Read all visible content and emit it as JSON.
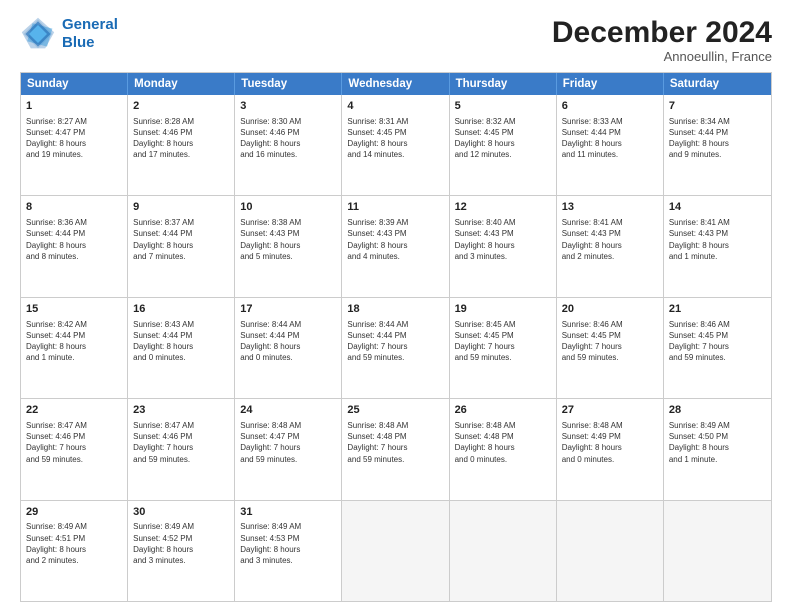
{
  "header": {
    "logo_line1": "General",
    "logo_line2": "Blue",
    "month": "December 2024",
    "location": "Annoeullin, France"
  },
  "days_of_week": [
    "Sunday",
    "Monday",
    "Tuesday",
    "Wednesday",
    "Thursday",
    "Friday",
    "Saturday"
  ],
  "weeks": [
    [
      {
        "day": "1",
        "lines": [
          "Sunrise: 8:27 AM",
          "Sunset: 4:47 PM",
          "Daylight: 8 hours",
          "and 19 minutes."
        ]
      },
      {
        "day": "2",
        "lines": [
          "Sunrise: 8:28 AM",
          "Sunset: 4:46 PM",
          "Daylight: 8 hours",
          "and 17 minutes."
        ]
      },
      {
        "day": "3",
        "lines": [
          "Sunrise: 8:30 AM",
          "Sunset: 4:46 PM",
          "Daylight: 8 hours",
          "and 16 minutes."
        ]
      },
      {
        "day": "4",
        "lines": [
          "Sunrise: 8:31 AM",
          "Sunset: 4:45 PM",
          "Daylight: 8 hours",
          "and 14 minutes."
        ]
      },
      {
        "day": "5",
        "lines": [
          "Sunrise: 8:32 AM",
          "Sunset: 4:45 PM",
          "Daylight: 8 hours",
          "and 12 minutes."
        ]
      },
      {
        "day": "6",
        "lines": [
          "Sunrise: 8:33 AM",
          "Sunset: 4:44 PM",
          "Daylight: 8 hours",
          "and 11 minutes."
        ]
      },
      {
        "day": "7",
        "lines": [
          "Sunrise: 8:34 AM",
          "Sunset: 4:44 PM",
          "Daylight: 8 hours",
          "and 9 minutes."
        ]
      }
    ],
    [
      {
        "day": "8",
        "lines": [
          "Sunrise: 8:36 AM",
          "Sunset: 4:44 PM",
          "Daylight: 8 hours",
          "and 8 minutes."
        ]
      },
      {
        "day": "9",
        "lines": [
          "Sunrise: 8:37 AM",
          "Sunset: 4:44 PM",
          "Daylight: 8 hours",
          "and 7 minutes."
        ]
      },
      {
        "day": "10",
        "lines": [
          "Sunrise: 8:38 AM",
          "Sunset: 4:43 PM",
          "Daylight: 8 hours",
          "and 5 minutes."
        ]
      },
      {
        "day": "11",
        "lines": [
          "Sunrise: 8:39 AM",
          "Sunset: 4:43 PM",
          "Daylight: 8 hours",
          "and 4 minutes."
        ]
      },
      {
        "day": "12",
        "lines": [
          "Sunrise: 8:40 AM",
          "Sunset: 4:43 PM",
          "Daylight: 8 hours",
          "and 3 minutes."
        ]
      },
      {
        "day": "13",
        "lines": [
          "Sunrise: 8:41 AM",
          "Sunset: 4:43 PM",
          "Daylight: 8 hours",
          "and 2 minutes."
        ]
      },
      {
        "day": "14",
        "lines": [
          "Sunrise: 8:41 AM",
          "Sunset: 4:43 PM",
          "Daylight: 8 hours",
          "and 1 minute."
        ]
      }
    ],
    [
      {
        "day": "15",
        "lines": [
          "Sunrise: 8:42 AM",
          "Sunset: 4:44 PM",
          "Daylight: 8 hours",
          "and 1 minute."
        ]
      },
      {
        "day": "16",
        "lines": [
          "Sunrise: 8:43 AM",
          "Sunset: 4:44 PM",
          "Daylight: 8 hours",
          "and 0 minutes."
        ]
      },
      {
        "day": "17",
        "lines": [
          "Sunrise: 8:44 AM",
          "Sunset: 4:44 PM",
          "Daylight: 8 hours",
          "and 0 minutes."
        ]
      },
      {
        "day": "18",
        "lines": [
          "Sunrise: 8:44 AM",
          "Sunset: 4:44 PM",
          "Daylight: 7 hours",
          "and 59 minutes."
        ]
      },
      {
        "day": "19",
        "lines": [
          "Sunrise: 8:45 AM",
          "Sunset: 4:45 PM",
          "Daylight: 7 hours",
          "and 59 minutes."
        ]
      },
      {
        "day": "20",
        "lines": [
          "Sunrise: 8:46 AM",
          "Sunset: 4:45 PM",
          "Daylight: 7 hours",
          "and 59 minutes."
        ]
      },
      {
        "day": "21",
        "lines": [
          "Sunrise: 8:46 AM",
          "Sunset: 4:45 PM",
          "Daylight: 7 hours",
          "and 59 minutes."
        ]
      }
    ],
    [
      {
        "day": "22",
        "lines": [
          "Sunrise: 8:47 AM",
          "Sunset: 4:46 PM",
          "Daylight: 7 hours",
          "and 59 minutes."
        ]
      },
      {
        "day": "23",
        "lines": [
          "Sunrise: 8:47 AM",
          "Sunset: 4:46 PM",
          "Daylight: 7 hours",
          "and 59 minutes."
        ]
      },
      {
        "day": "24",
        "lines": [
          "Sunrise: 8:48 AM",
          "Sunset: 4:47 PM",
          "Daylight: 7 hours",
          "and 59 minutes."
        ]
      },
      {
        "day": "25",
        "lines": [
          "Sunrise: 8:48 AM",
          "Sunset: 4:48 PM",
          "Daylight: 7 hours",
          "and 59 minutes."
        ]
      },
      {
        "day": "26",
        "lines": [
          "Sunrise: 8:48 AM",
          "Sunset: 4:48 PM",
          "Daylight: 8 hours",
          "and 0 minutes."
        ]
      },
      {
        "day": "27",
        "lines": [
          "Sunrise: 8:48 AM",
          "Sunset: 4:49 PM",
          "Daylight: 8 hours",
          "and 0 minutes."
        ]
      },
      {
        "day": "28",
        "lines": [
          "Sunrise: 8:49 AM",
          "Sunset: 4:50 PM",
          "Daylight: 8 hours",
          "and 1 minute."
        ]
      }
    ],
    [
      {
        "day": "29",
        "lines": [
          "Sunrise: 8:49 AM",
          "Sunset: 4:51 PM",
          "Daylight: 8 hours",
          "and 2 minutes."
        ]
      },
      {
        "day": "30",
        "lines": [
          "Sunrise: 8:49 AM",
          "Sunset: 4:52 PM",
          "Daylight: 8 hours",
          "and 3 minutes."
        ]
      },
      {
        "day": "31",
        "lines": [
          "Sunrise: 8:49 AM",
          "Sunset: 4:53 PM",
          "Daylight: 8 hours",
          "and 3 minutes."
        ]
      },
      {
        "day": "",
        "lines": []
      },
      {
        "day": "",
        "lines": []
      },
      {
        "day": "",
        "lines": []
      },
      {
        "day": "",
        "lines": []
      }
    ]
  ]
}
